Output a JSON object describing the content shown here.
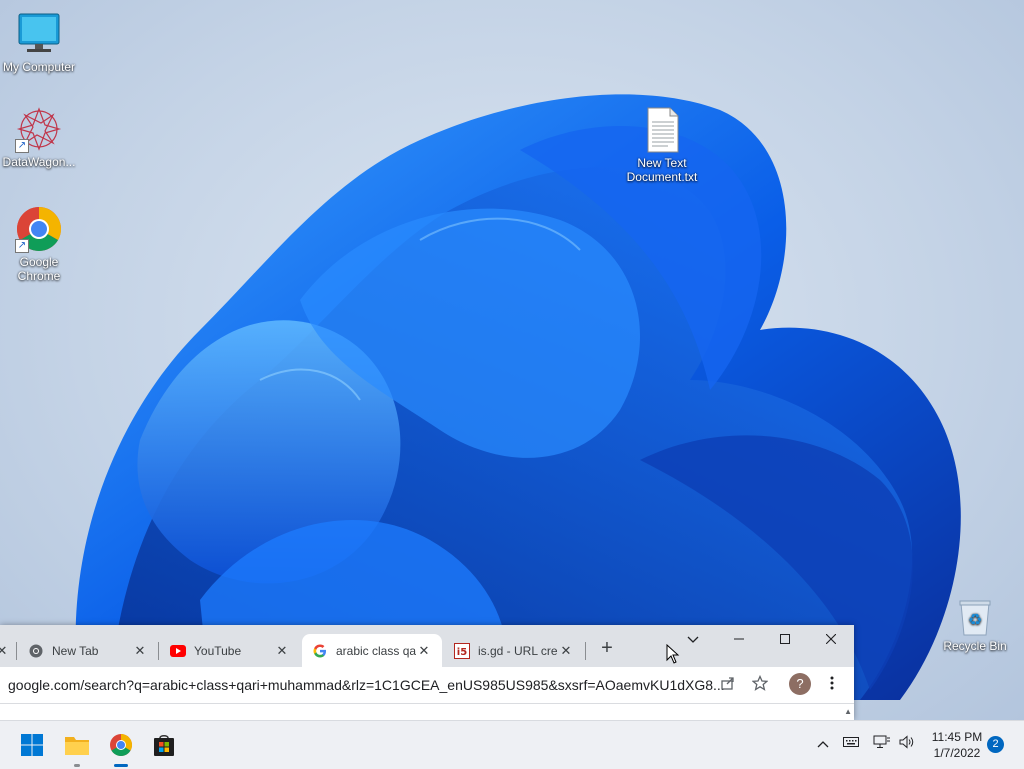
{
  "desktop": {
    "icons": [
      {
        "label": "My Computer",
        "icon": "computer-icon"
      },
      {
        "label": "DataWagon...",
        "icon": "datawagon-icon"
      },
      {
        "label": "Google Chrome",
        "icon": "chrome-icon"
      },
      {
        "label": "New Text Document.txt",
        "icon": "text-file-icon"
      },
      {
        "label": "Recycle Bin",
        "icon": "recycle-bin-icon"
      }
    ]
  },
  "chrome": {
    "tabs": [
      {
        "title": "New Tab",
        "favicon": "chrome-favicon"
      },
      {
        "title": "YouTube",
        "favicon": "youtube-favicon"
      },
      {
        "title": "arabic class qari",
        "favicon": "google-favicon",
        "active": true
      },
      {
        "title": "is.gd - URL cre",
        "favicon": "isgd-favicon"
      }
    ],
    "new_tab_glyph": "+",
    "address": "google.com/search?q=arabic+class+qari+muhammad&rlz=1C1GCEA_enUS985US985&sxsrf=AOaemvKU1dXG8...",
    "profile_initial": "?"
  },
  "taskbar": {
    "apps": [
      "start-icon",
      "file-explorer-icon",
      "chrome-icon",
      "store-icon"
    ],
    "clock_time": "11:45 PM",
    "clock_date": "1/7/2022",
    "notification_count": "2"
  }
}
